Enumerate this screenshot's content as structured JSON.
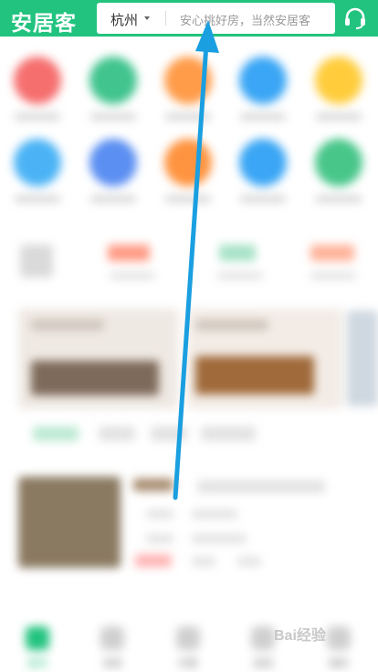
{
  "header": {
    "logo": "安居客",
    "city": "杭州",
    "search_placeholder": "安心挑好房，当然安居客"
  },
  "icons": {
    "support": "headset-icon"
  },
  "tabbar": {
    "items": [
      "首页",
      "消息",
      "问答",
      "发现",
      "我的"
    ]
  },
  "watermark": "Bai经验",
  "colors": {
    "brand": "#22c37f",
    "arrow": "#1a9fe0"
  }
}
